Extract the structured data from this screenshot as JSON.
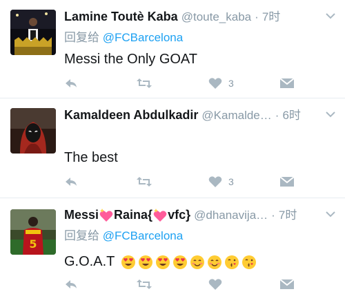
{
  "tweets": [
    {
      "display_name": "Lamine Toutè Kaba",
      "handle": "@toute_kaba",
      "time": "7时",
      "reply_prefix": "回复给 ",
      "reply_mention": "@FCBarcelona",
      "text": "Messi the Only GOAT",
      "like_count": "3",
      "avatar_icon": "avatar-photo-trophy"
    },
    {
      "display_name": "Kamaldeen Abdulkadir",
      "handle": "@Kamalde…",
      "time": "6时",
      "text": "The best",
      "like_count": "3",
      "avatar_icon": "avatar-photo-hooded-figure"
    },
    {
      "display_name_a": "Messi",
      "display_name_b": "Raina{",
      "display_name_c": "vfc}",
      "handle": "@dhanavija…",
      "time": "7时",
      "reply_prefix": "回复给 ",
      "reply_mention": "@FCBarcelona",
      "text": "G.O.A.T",
      "emojis": [
        "heart-eyes-face-icon",
        "heart-eyes-face-icon",
        "heart-eyes-face-icon",
        "heart-eyes-face-icon",
        "smiling-face-icon",
        "smiling-face-icon",
        "kissing-face-icon",
        "kissing-face-icon"
      ],
      "avatar_icon": "avatar-photo-player-number-5"
    }
  ],
  "separator": "·",
  "colors": {
    "meta": "#8899a6",
    "link": "#1da1f2",
    "text": "#14171a",
    "divider": "#e6ecf0",
    "icon": "#aab8c2"
  }
}
